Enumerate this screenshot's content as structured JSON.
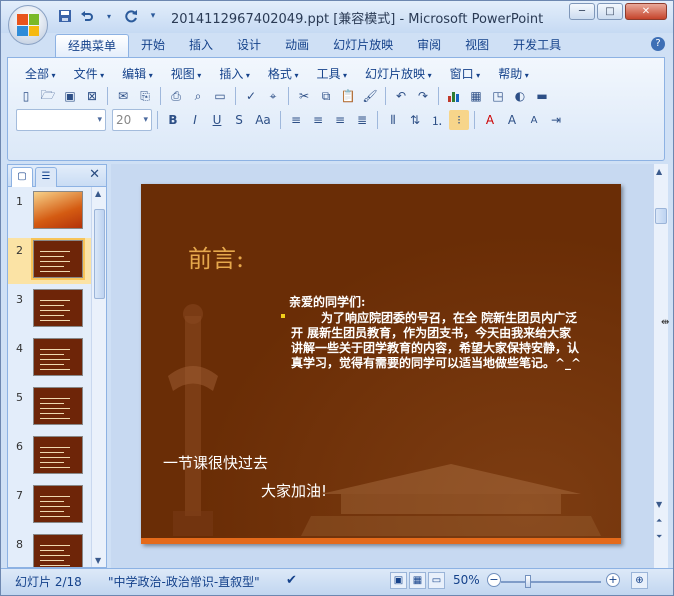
{
  "window": {
    "title": "2014112967402049.ppt [兼容模式] - Microsoft PowerPoint",
    "controls": {
      "minimize": "─",
      "maximize": "□",
      "close": "✕"
    }
  },
  "qat": {
    "save_icon": "save-icon",
    "undo_icon": "undo-icon",
    "redo_icon": "redo-icon",
    "customize": "▾"
  },
  "tabs": [
    {
      "label": "经典菜单",
      "active": true
    },
    {
      "label": "开始"
    },
    {
      "label": "插入"
    },
    {
      "label": "设计"
    },
    {
      "label": "动画"
    },
    {
      "label": "幻灯片放映"
    },
    {
      "label": "审阅"
    },
    {
      "label": "视图"
    },
    {
      "label": "开发工具"
    }
  ],
  "help": "?",
  "menus": [
    "全部",
    "文件",
    "编辑",
    "视图",
    "插入",
    "格式",
    "工具",
    "幻灯片放映",
    "窗口",
    "帮助"
  ],
  "font_size_value": "20",
  "format_buttons": {
    "bold": "B",
    "italic": "I",
    "underline": "U",
    "strike": "S",
    "case": "Aa"
  },
  "thumbnails": [
    {
      "num": "1"
    },
    {
      "num": "2",
      "selected": true
    },
    {
      "num": "3"
    },
    {
      "num": "4"
    },
    {
      "num": "5"
    },
    {
      "num": "6"
    },
    {
      "num": "7"
    },
    {
      "num": "8"
    }
  ],
  "slide": {
    "title": "前言:",
    "intro": "亲爱的同学们:",
    "body": "为了响应院团委的号召，在全 院新生团员内广泛开 展新生团员教育，作为团支书，今天由我来给大家讲解一些关于团学教育的内容，希望大家保持安静，认真学习，觉得有需要的同学可以适当地做些笔记。^_^",
    "line1": "一节课很快过去",
    "line2": "大家加油!"
  },
  "status": {
    "slide_info": "幻灯片 2/18",
    "theme": "\"中学政治-政治常识-直叙型\"",
    "zoom": "50%",
    "zoom_out": "−",
    "zoom_in": "+"
  },
  "colors": {
    "slide_bg": "#6a2d06",
    "title_color": "#e6a84c",
    "accent_bar": "#e56a1a"
  }
}
